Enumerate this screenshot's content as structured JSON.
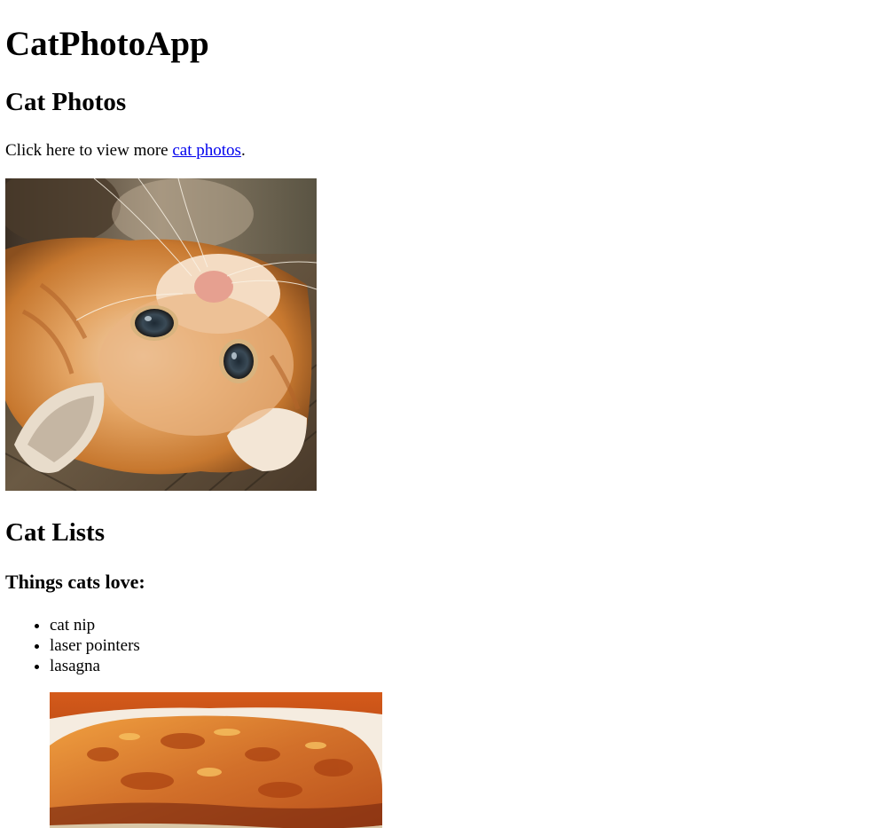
{
  "header": {
    "app_title": "CatPhotoApp"
  },
  "photos_section": {
    "heading": "Cat Photos",
    "intro_text": "Click here to view more ",
    "link_text": "cat photos",
    "intro_suffix": ".",
    "image_icon": "orange-kitten-photo"
  },
  "lists_section": {
    "heading": "Cat Lists",
    "subheading": "Things cats love:",
    "items": [
      "cat nip",
      "laser pointers",
      "lasagna"
    ],
    "image_icon": "lasagna-photo"
  },
  "colors": {
    "link": "#0000ee",
    "text": "#000000",
    "background": "#ffffff"
  }
}
